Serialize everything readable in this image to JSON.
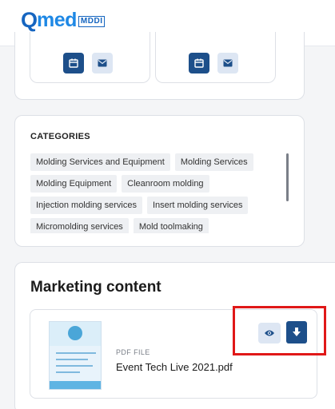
{
  "header": {
    "logo_q": "Q",
    "logo_med": "med",
    "logo_badge": "MDDI"
  },
  "contacts": [
    {
      "calendar_icon": "calendar-icon",
      "mail_icon": "mail-icon"
    },
    {
      "calendar_icon": "calendar-icon",
      "mail_icon": "mail-icon"
    }
  ],
  "categories": {
    "title": "CATEGORIES",
    "rows": [
      [
        "Molding Services and Equipment",
        "Molding Services"
      ],
      [
        "Molding Equipment",
        "Cleanroom molding"
      ],
      [
        "Injection molding services",
        "Insert molding services"
      ],
      [
        "Micromolding services",
        "Mold toolmaking"
      ]
    ]
  },
  "marketing": {
    "title": "Marketing content",
    "file": {
      "type": "PDF FILE",
      "name": "Event Tech Live 2021.pdf"
    },
    "view_icon": "eye-icon",
    "download_icon": "download-icon"
  },
  "colors": {
    "primary": "#1d4f8a",
    "light_button": "#dde6f3",
    "highlight": "#e01818"
  }
}
